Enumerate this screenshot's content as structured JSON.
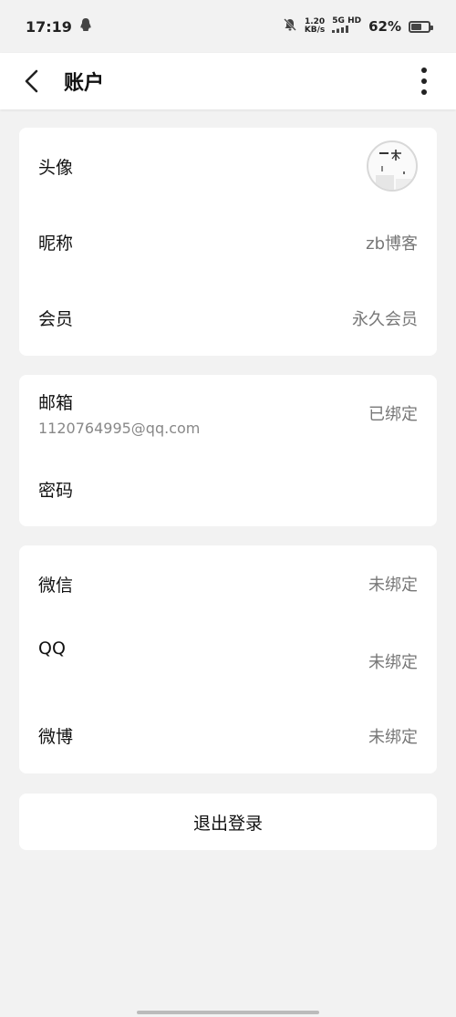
{
  "status_bar": {
    "time": "17:19",
    "net_speed_top": "1.20",
    "net_speed_bottom": "KB/s",
    "network": "5G HD",
    "battery_percent": "62%",
    "battery_level": 0.62
  },
  "app_bar": {
    "title": "账户"
  },
  "profile_card": {
    "avatar_label": "头像",
    "nickname_label": "昵称",
    "nickname_value": "zb博客",
    "member_label": "会员",
    "member_value": "永久会员"
  },
  "security_card": {
    "email_label": "邮箱",
    "email_value": "1120764995@qq.com",
    "email_status": "已绑定",
    "password_label": "密码"
  },
  "social_card": {
    "wechat_label": "微信",
    "wechat_status": "未绑定",
    "qq_label": "QQ",
    "qq_status": "未绑定",
    "weibo_label": "微博",
    "weibo_status": "未绑定"
  },
  "logout_label": "退出登录",
  "colors": {
    "background": "#f2f2f2",
    "card": "#ffffff",
    "secondary_text": "#777777"
  }
}
